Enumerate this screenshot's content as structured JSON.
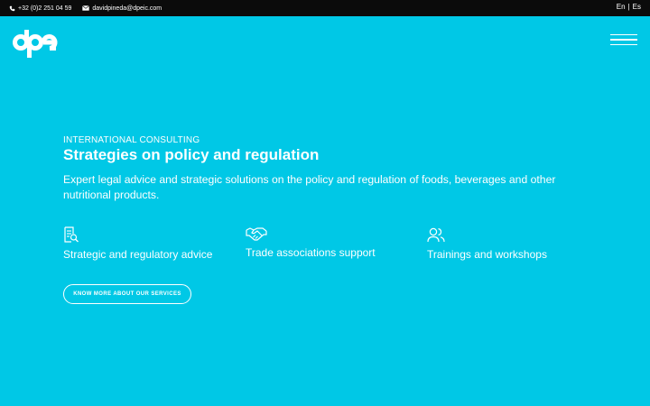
{
  "topbar": {
    "phone": "+32 (0)2 251 04 59",
    "email": "davidpineda@dpeic.com",
    "lang_en": "En",
    "lang_sep": "|",
    "lang_es": "Es"
  },
  "brand": {
    "logo_text": "dpe",
    "logo_icon": "dpe-logo"
  },
  "header": {
    "menu_icon": "hamburger-menu-icon"
  },
  "hero": {
    "eyebrow": "INTERNATIONAL CONSULTING",
    "title": "Strategies on policy and regulation",
    "lead": "Expert legal advice and strategic solutions on the policy and regulation of foods, beverages and other nutritional products."
  },
  "services": [
    {
      "icon": "document-search-icon",
      "label": "Strategic and regulatory advice"
    },
    {
      "icon": "handshake-icon",
      "label": "Trade associations support"
    },
    {
      "icon": "users-icon",
      "label": "Trainings and workshops"
    }
  ],
  "cta": {
    "label": "KNOW MORE ABOUT OUR SERVICES"
  },
  "colors": {
    "background": "#00c8e6",
    "topbar": "#0b0b0b",
    "text": "#ffffff"
  }
}
